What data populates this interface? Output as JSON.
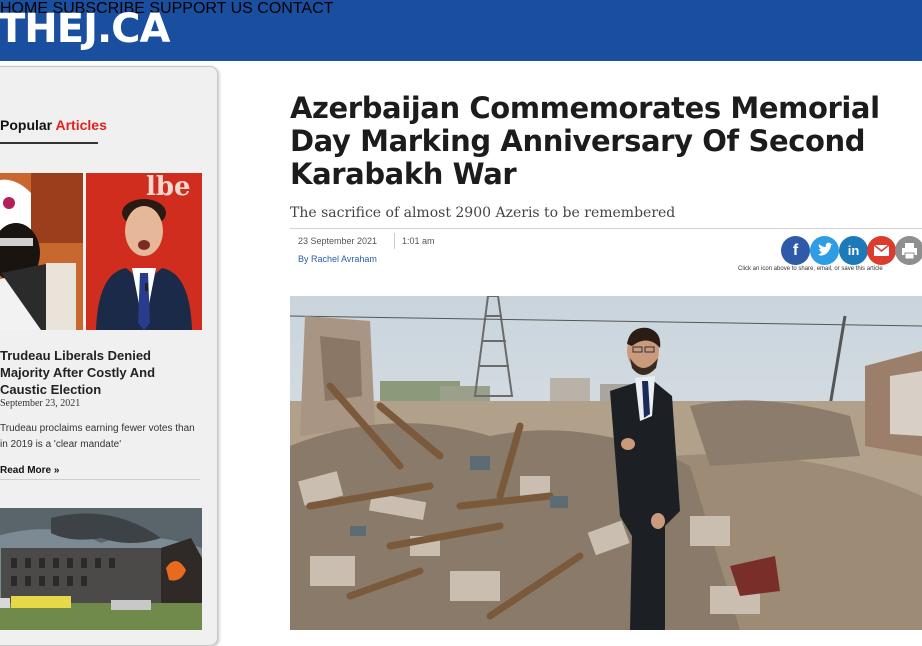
{
  "header": {
    "logo": "THEJ.CA",
    "nav": [
      "HOME",
      "SUBSCRIBE",
      "SUPPORT US",
      "CONTACT"
    ],
    "bg_color": "#1a4fa0"
  },
  "sidebar": {
    "heading_part1": "Popular",
    "heading_part2": "Articles",
    "accent_color": "#e2201c",
    "article": {
      "title": "Trudeau Liberals Denied Majority After Costly And Caustic Election",
      "date": "September 23, 2021",
      "excerpt": "Trudeau proclaims earning fewer votes than in 2019 is a 'clear mandate'",
      "read_more": "Read More »"
    }
  },
  "article": {
    "headline": "Azerbaijan Commemorates Memorial Day Marking Anniversary Of Second Karabakh War",
    "subtitle": "The sacrifice of almost 2900 Azeris to be remembered",
    "date": "23 September 2021",
    "time": "1:01 am",
    "byline": "By Rachel Avraham",
    "share_note": "Click an icon above to share, email, or save this article",
    "share_icons": [
      "facebook-icon",
      "twitter-icon",
      "linkedin-icon",
      "email-icon",
      "print-icon"
    ]
  }
}
